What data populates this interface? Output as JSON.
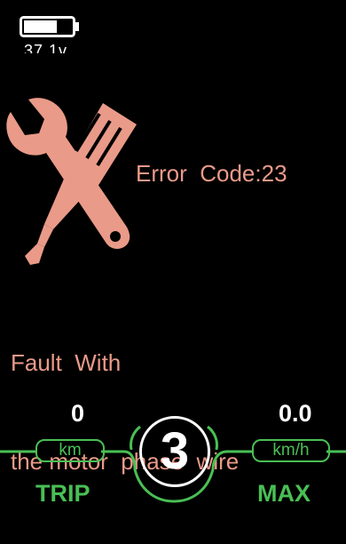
{
  "status": {
    "voltage": "37.1v",
    "battery_icon": "battery-icon",
    "battery_level": 0.7
  },
  "error": {
    "icon": "tools-icon",
    "code_text": "Error  Code:23",
    "message_line1": "Fault  With",
    "message_line2": "the motor  phase  wire"
  },
  "dashboard": {
    "trip_value": "0",
    "trip_unit": "km",
    "trip_label": "TRIP",
    "speed_value": "0.0",
    "speed_unit": "km/h",
    "speed_label": "MAX",
    "gear": "3"
  },
  "colors": {
    "error_text": "#ea9a88",
    "accent_green": "#49bf55",
    "background": "#000000"
  }
}
